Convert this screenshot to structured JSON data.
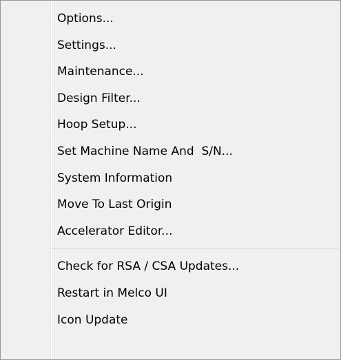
{
  "menu": {
    "group1": [
      {
        "label": "Options..."
      },
      {
        "label": "Settings..."
      },
      {
        "label": "Maintenance..."
      },
      {
        "label": "Design Filter..."
      },
      {
        "label": "Hoop Setup..."
      },
      {
        "label": "Set Machine Name And  S/N..."
      },
      {
        "label": "System Information"
      },
      {
        "label": "Move To Last Origin"
      },
      {
        "label": "Accelerator Editor..."
      }
    ],
    "group2": [
      {
        "label": "Check for RSA / CSA Updates..."
      },
      {
        "label": "Restart in Melco UI"
      },
      {
        "label": "Icon Update"
      }
    ]
  }
}
